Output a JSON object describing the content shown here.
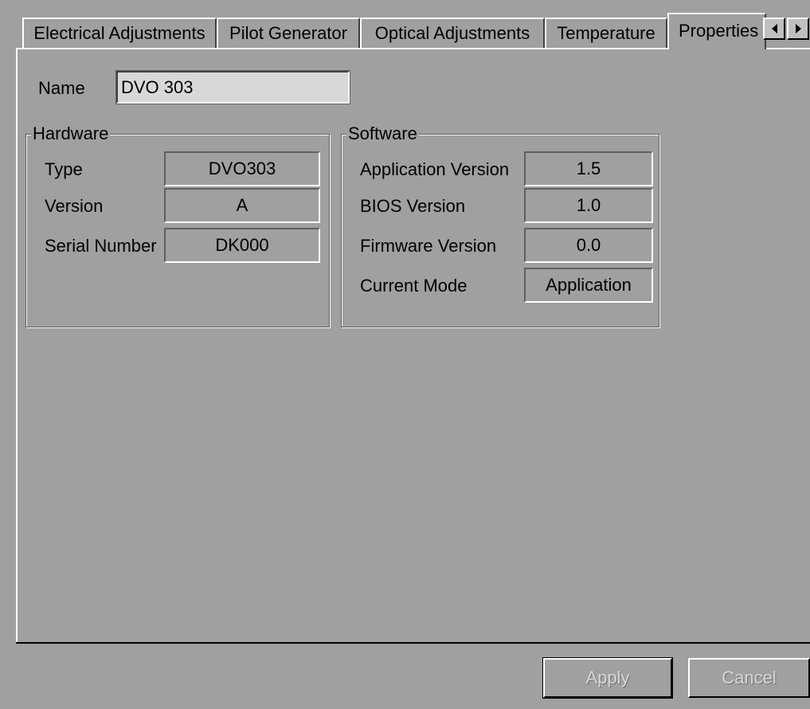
{
  "tabs": [
    {
      "label": "Electrical Adjustments"
    },
    {
      "label": "Pilot Generator"
    },
    {
      "label": "Optical Adjustments"
    },
    {
      "label": "Temperature"
    },
    {
      "label": "Properties",
      "active": true
    }
  ],
  "name": {
    "label": "Name",
    "value": "DVO 303"
  },
  "hardware": {
    "title": "Hardware",
    "type_label": "Type",
    "type_value": "DVO303",
    "version_label": "Version",
    "version_value": "A",
    "serial_label": "Serial Number",
    "serial_value": "DK000"
  },
  "software": {
    "title": "Software",
    "app_label": "Application Version",
    "app_value": "1.5",
    "bios_label": "BIOS Version",
    "bios_value": "1.0",
    "firmware_label": "Firmware Version",
    "firmware_value": "0.0",
    "mode_label": "Current Mode",
    "mode_value": "Application"
  },
  "buttons": {
    "apply": "Apply",
    "cancel": "Cancel"
  },
  "colors": {
    "face": "#a0a0a0",
    "highlight": "#ffffff",
    "shadow": "#404040"
  }
}
